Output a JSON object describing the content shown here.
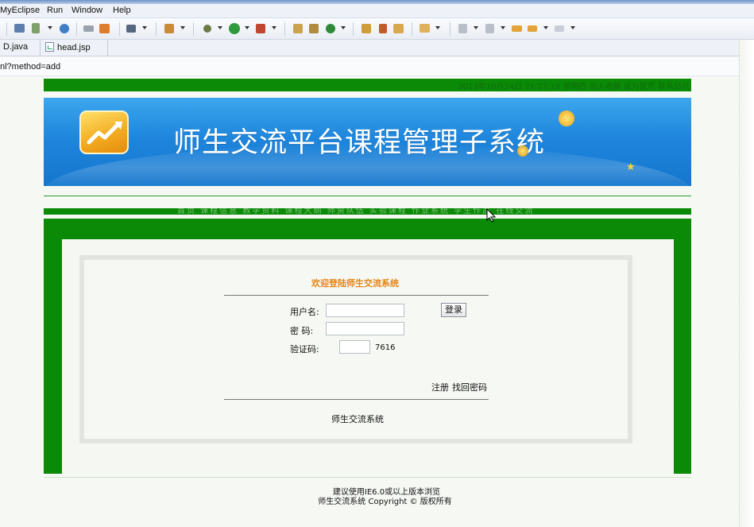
{
  "ide": {
    "menu": [
      "MyEclipse",
      "Run",
      "Window",
      "Help"
    ],
    "tabs": [
      {
        "label": "D.java"
      },
      {
        "label": "head.jsp"
      }
    ],
    "url": "nl?method=add"
  },
  "page": {
    "topbar_text": "2013年10月24日 21:27:18  星期四  加入收藏 设为首页 联系站长",
    "banner_title": "师生交流平台课程管理子系统",
    "nav_text": "首页  课程信息  教学资料  课程大纲  师资队伍  实验课程  作业系统  学生作品  在线交流",
    "login": {
      "welcome": "欢迎登陆师生交流系统",
      "username_label": "用户名:",
      "username_value": "",
      "password_label": "密   码:",
      "password_value": "",
      "captcha_label": "验证码:",
      "captcha_value": "",
      "captcha_code": "7616",
      "login_button": "登录",
      "register_link": "注册",
      "forgot_link": "找回密码",
      "system_name": "师生交流系统"
    },
    "footer": {
      "line1": "建议使用IE6.0或以上版本浏览",
      "line2": "师生交流系统 Copyright © 版权所有"
    }
  },
  "colors": {
    "green": "#0a8a06",
    "banner_blue": "#1f86dd",
    "welcome_orange": "#e68412"
  }
}
